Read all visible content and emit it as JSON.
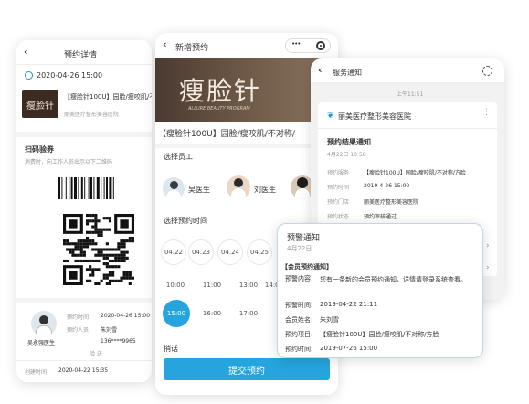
{
  "p1": {
    "back": "‹",
    "title": "预约详情",
    "datetime": "2020-04-26 15:00",
    "banner_text": "瘦脸针",
    "product": "【瘦脸针100U】园脸/瘦咬肌/不对",
    "hospital": "丽美医疗整形美容医院",
    "scan_title": "扫码验券",
    "scan_hint": "消费时，向工作人员出示以下二维码",
    "avatar_name": "吴永强医生",
    "rows": [
      {
        "k": "预约时间",
        "v": "2020-04-26 15:00"
      },
      {
        "k": "预约人员",
        "v": "朱刘雪"
      },
      {
        "k": "",
        "v": "136****9965"
      },
      {
        "k": "",
        "v": "验  送"
      }
    ],
    "created_label": "创建时间",
    "created_value": "2020-04-22 15:35"
  },
  "p2": {
    "back": "‹",
    "title": "新增预约",
    "menu": "•••",
    "banner_text": "瘦脸针",
    "banner_sub": "ALLURE BEAUTY PROGRAM",
    "product": "【瘦脸针100U】园脸/瘦咬肌/不对称/",
    "select_staff": "选择员工",
    "staff": [
      "吴医生",
      "刘医生"
    ],
    "select_time": "选择预约时间",
    "dates": [
      "04.22",
      "04.23",
      "04.24",
      "04.25"
    ],
    "times": [
      "10:00",
      "11:00",
      "13:00",
      "14:00",
      "15:00",
      "16:00",
      "17:00"
    ],
    "remark": "捎话",
    "submit": "提交预约"
  },
  "p3": {
    "back": "‹",
    "title": "服务通知",
    "timestamp": "上午11:51",
    "hospital": "丽美医疗整形美容医院",
    "notice_title": "预约结果通知",
    "notice_date": "4月22日 10:58",
    "rows": [
      {
        "k": "预约服务",
        "v": "【瘦脸针100U】园脸/瘦咬肌/不对称/方脸"
      },
      {
        "k": "预约时间",
        "v": "2019-4-26 15:00"
      },
      {
        "k": "预约门店",
        "v": "丽美医疗整形美容医院"
      },
      {
        "k": "预约状态",
        "v": "预约审核通过"
      }
    ]
  },
  "popup": {
    "title": "预警通知",
    "date": "4月22日",
    "tag": "【会员预约通知】",
    "content_label": "预警内容:",
    "content": "您有一条新的会员预约通知，详情请登录系统查看。",
    "time_label": "预警时间:",
    "time": "2019-04-22 21:11",
    "member_label": "会员姓名:",
    "member": "朱刘雪",
    "item_label": "预约项目:",
    "item": "【瘦脸针100U】园脸/瘦咬肌/不对称/方脸",
    "appt_label": "预约时间:",
    "appt": "2019-07-26 15:00"
  },
  "colors": {
    "accent": "#1c93d0",
    "button": "#26a4dd"
  }
}
